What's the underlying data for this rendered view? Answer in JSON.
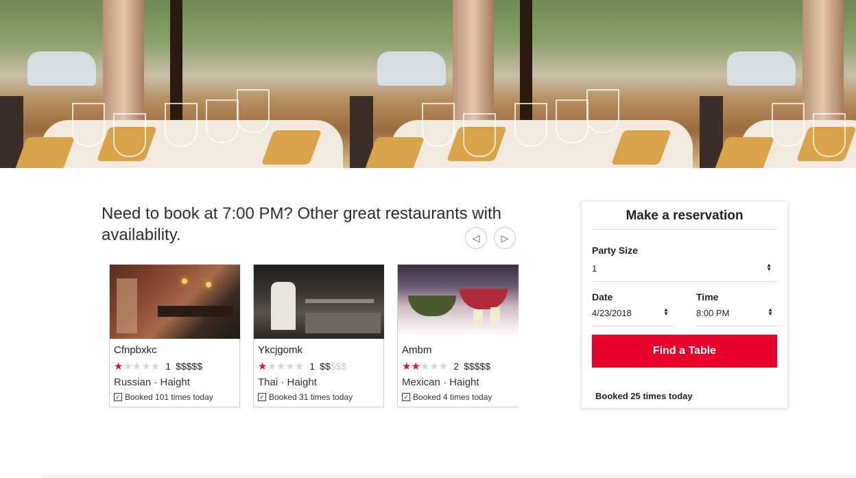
{
  "colors": {
    "accent": "#e8002d",
    "star_on": "#e8102e",
    "star_off": "#d5d5d5"
  },
  "heading": "Need to book at 7:00 PM? Other great restaurants with availability.",
  "nav": {
    "prev_icon": "◁",
    "next_icon": "▷"
  },
  "restaurants": [
    {
      "name": "Cfnpbxkc",
      "stars": 1,
      "rating": "1",
      "price_on": "$$$$$",
      "price_off": "",
      "cuisine": "Russian · Haight",
      "booked": "Booked 101 times today",
      "image": "brick-wall-bar-photo"
    },
    {
      "name": "Ykcjgomk",
      "stars": 1,
      "rating": "1",
      "price_on": "$$",
      "price_off": "$$$",
      "cuisine": "Thai · Haight",
      "booked": "Booked 31 times today",
      "image": "kitchen-chef-photo"
    },
    {
      "name": "Ambm",
      "stars": 2,
      "rating": "2",
      "price_on": "$$$$$",
      "price_off": "",
      "cuisine": "Mexican · Haight",
      "booked": "Booked 4 times today",
      "image": "buffet-table-photo"
    }
  ],
  "reservation": {
    "title": "Make a reservation",
    "party_size_label": "Party Size",
    "party_size_value": "1",
    "date_label": "Date",
    "date_value": "4/23/2018",
    "time_label": "Time",
    "time_value": "8:00 PM",
    "find_button": "Find a Table",
    "booked_today": "Booked 25 times today"
  }
}
